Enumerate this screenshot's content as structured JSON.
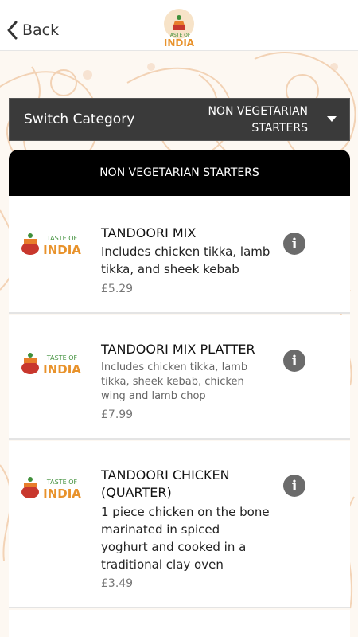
{
  "header": {
    "back_label": "Back",
    "logo_text_top": "TASTE OF",
    "logo_text_bottom": "INDIA"
  },
  "switch_category": {
    "label": "Switch Category",
    "value_line1": "NON VEGETARIAN",
    "value_line2": "STARTERS"
  },
  "category_title": "NON VEGETARIAN STARTERS",
  "items": [
    {
      "name": "TANDOORI MIX",
      "description_lines": [
        "Includes chicken tikka, lamb",
        "tikka, and sheek kebab"
      ],
      "price": "£5.29"
    },
    {
      "name": "TANDOORI MIX PLATTER",
      "description_lines": [
        "Includes chicken tikka, lamb",
        "tikka, sheek kebab, chicken",
        "wing and lamb chop"
      ],
      "price": "£7.99"
    },
    {
      "name_lines": [
        "TANDOORI CHICKEN",
        "(QUARTER)"
      ],
      "description_lines": [
        "1 piece chicken on the bone",
        "marinated in spiced",
        "yoghurt and cooked in a",
        "traditional clay oven"
      ],
      "price": "£3.49"
    }
  ],
  "colors": {
    "accent_orange": "#e87d2b",
    "logo_red": "#c8372d",
    "logo_green": "#3f8f3a",
    "dark_bar": "#3a3a3a",
    "header_black": "#000000"
  },
  "icons": {
    "back": "chevron-left-icon",
    "info": "info-icon",
    "dropdown": "caret-down-icon"
  }
}
